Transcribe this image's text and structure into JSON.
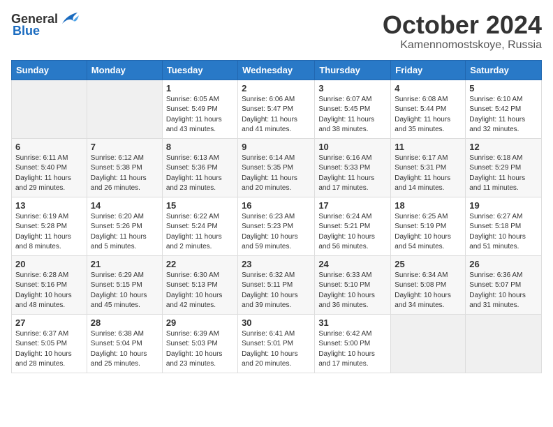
{
  "header": {
    "logo_general": "General",
    "logo_blue": "Blue",
    "month": "October 2024",
    "location": "Kamennomostskoye, Russia"
  },
  "weekdays": [
    "Sunday",
    "Monday",
    "Tuesday",
    "Wednesday",
    "Thursday",
    "Friday",
    "Saturday"
  ],
  "weeks": [
    [
      {
        "day": "",
        "info": ""
      },
      {
        "day": "",
        "info": ""
      },
      {
        "day": "1",
        "info": "Sunrise: 6:05 AM\nSunset: 5:49 PM\nDaylight: 11 hours and 43 minutes."
      },
      {
        "day": "2",
        "info": "Sunrise: 6:06 AM\nSunset: 5:47 PM\nDaylight: 11 hours and 41 minutes."
      },
      {
        "day": "3",
        "info": "Sunrise: 6:07 AM\nSunset: 5:45 PM\nDaylight: 11 hours and 38 minutes."
      },
      {
        "day": "4",
        "info": "Sunrise: 6:08 AM\nSunset: 5:44 PM\nDaylight: 11 hours and 35 minutes."
      },
      {
        "day": "5",
        "info": "Sunrise: 6:10 AM\nSunset: 5:42 PM\nDaylight: 11 hours and 32 minutes."
      }
    ],
    [
      {
        "day": "6",
        "info": "Sunrise: 6:11 AM\nSunset: 5:40 PM\nDaylight: 11 hours and 29 minutes."
      },
      {
        "day": "7",
        "info": "Sunrise: 6:12 AM\nSunset: 5:38 PM\nDaylight: 11 hours and 26 minutes."
      },
      {
        "day": "8",
        "info": "Sunrise: 6:13 AM\nSunset: 5:36 PM\nDaylight: 11 hours and 23 minutes."
      },
      {
        "day": "9",
        "info": "Sunrise: 6:14 AM\nSunset: 5:35 PM\nDaylight: 11 hours and 20 minutes."
      },
      {
        "day": "10",
        "info": "Sunrise: 6:16 AM\nSunset: 5:33 PM\nDaylight: 11 hours and 17 minutes."
      },
      {
        "day": "11",
        "info": "Sunrise: 6:17 AM\nSunset: 5:31 PM\nDaylight: 11 hours and 14 minutes."
      },
      {
        "day": "12",
        "info": "Sunrise: 6:18 AM\nSunset: 5:29 PM\nDaylight: 11 hours and 11 minutes."
      }
    ],
    [
      {
        "day": "13",
        "info": "Sunrise: 6:19 AM\nSunset: 5:28 PM\nDaylight: 11 hours and 8 minutes."
      },
      {
        "day": "14",
        "info": "Sunrise: 6:20 AM\nSunset: 5:26 PM\nDaylight: 11 hours and 5 minutes."
      },
      {
        "day": "15",
        "info": "Sunrise: 6:22 AM\nSunset: 5:24 PM\nDaylight: 11 hours and 2 minutes."
      },
      {
        "day": "16",
        "info": "Sunrise: 6:23 AM\nSunset: 5:23 PM\nDaylight: 10 hours and 59 minutes."
      },
      {
        "day": "17",
        "info": "Sunrise: 6:24 AM\nSunset: 5:21 PM\nDaylight: 10 hours and 56 minutes."
      },
      {
        "day": "18",
        "info": "Sunrise: 6:25 AM\nSunset: 5:19 PM\nDaylight: 10 hours and 54 minutes."
      },
      {
        "day": "19",
        "info": "Sunrise: 6:27 AM\nSunset: 5:18 PM\nDaylight: 10 hours and 51 minutes."
      }
    ],
    [
      {
        "day": "20",
        "info": "Sunrise: 6:28 AM\nSunset: 5:16 PM\nDaylight: 10 hours and 48 minutes."
      },
      {
        "day": "21",
        "info": "Sunrise: 6:29 AM\nSunset: 5:15 PM\nDaylight: 10 hours and 45 minutes."
      },
      {
        "day": "22",
        "info": "Sunrise: 6:30 AM\nSunset: 5:13 PM\nDaylight: 10 hours and 42 minutes."
      },
      {
        "day": "23",
        "info": "Sunrise: 6:32 AM\nSunset: 5:11 PM\nDaylight: 10 hours and 39 minutes."
      },
      {
        "day": "24",
        "info": "Sunrise: 6:33 AM\nSunset: 5:10 PM\nDaylight: 10 hours and 36 minutes."
      },
      {
        "day": "25",
        "info": "Sunrise: 6:34 AM\nSunset: 5:08 PM\nDaylight: 10 hours and 34 minutes."
      },
      {
        "day": "26",
        "info": "Sunrise: 6:36 AM\nSunset: 5:07 PM\nDaylight: 10 hours and 31 minutes."
      }
    ],
    [
      {
        "day": "27",
        "info": "Sunrise: 6:37 AM\nSunset: 5:05 PM\nDaylight: 10 hours and 28 minutes."
      },
      {
        "day": "28",
        "info": "Sunrise: 6:38 AM\nSunset: 5:04 PM\nDaylight: 10 hours and 25 minutes."
      },
      {
        "day": "29",
        "info": "Sunrise: 6:39 AM\nSunset: 5:03 PM\nDaylight: 10 hours and 23 minutes."
      },
      {
        "day": "30",
        "info": "Sunrise: 6:41 AM\nSunset: 5:01 PM\nDaylight: 10 hours and 20 minutes."
      },
      {
        "day": "31",
        "info": "Sunrise: 6:42 AM\nSunset: 5:00 PM\nDaylight: 10 hours and 17 minutes."
      },
      {
        "day": "",
        "info": ""
      },
      {
        "day": "",
        "info": ""
      }
    ]
  ]
}
